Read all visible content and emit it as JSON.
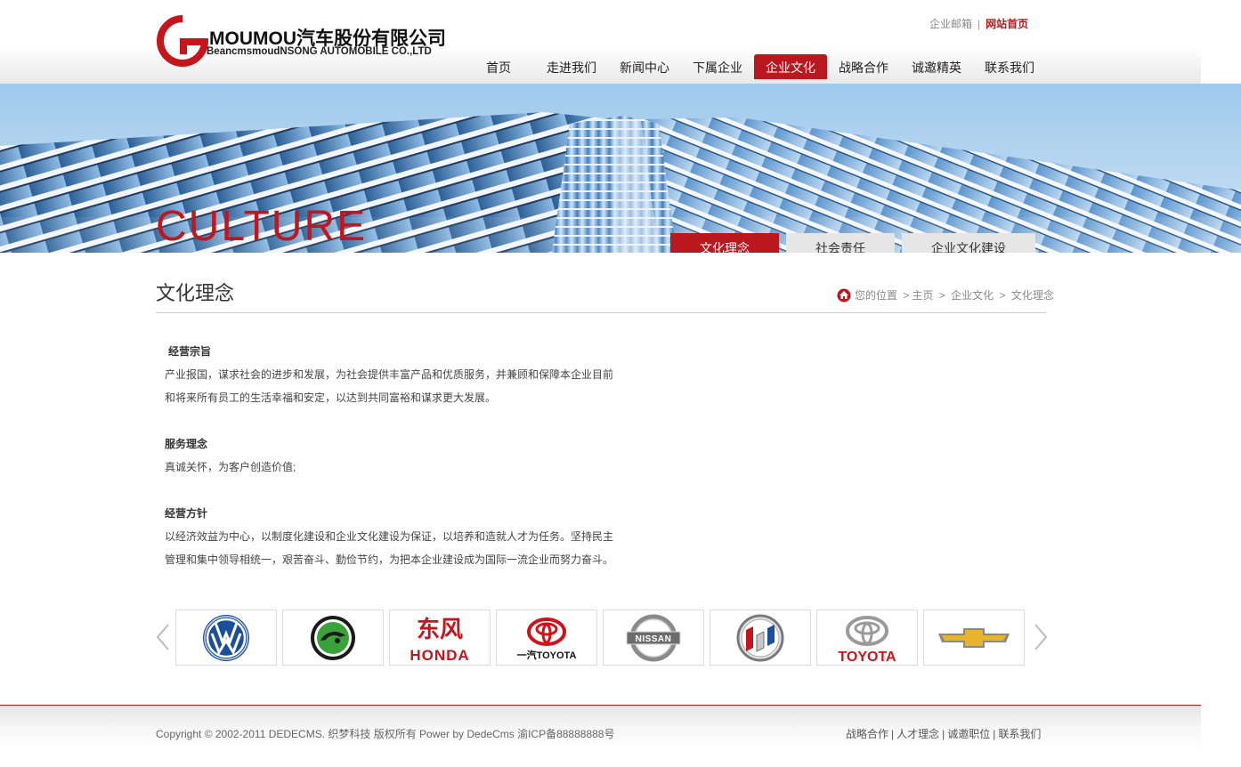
{
  "header": {
    "logo_cn_brand": "MOUMOU",
    "logo_cn_rest": "汽车股份有限公司",
    "logo_en": "BeancmsmoudNSONG AUTOMOBILE CO.,LTD",
    "top_links": {
      "mail": "企业邮箱",
      "separator": "|",
      "home": "网站首页"
    },
    "nav": [
      {
        "label": "首页",
        "active": false
      },
      {
        "label": "走进我们",
        "active": false
      },
      {
        "label": "新闻中心",
        "active": false
      },
      {
        "label": "下属企业",
        "active": false
      },
      {
        "label": "企业文化",
        "active": true
      },
      {
        "label": "战略合作",
        "active": false
      },
      {
        "label": "诚邀精英",
        "active": false
      },
      {
        "label": "联系我们",
        "active": false
      }
    ]
  },
  "banner": {
    "title": "CULTURE",
    "subtabs": [
      {
        "label": "文化理念",
        "active": true
      },
      {
        "label": "社会责任",
        "active": false
      },
      {
        "label": "企业文化建设",
        "active": false
      }
    ]
  },
  "content": {
    "title": "文化理念",
    "breadcrumb": {
      "prefix": "您的位置",
      "items": [
        "主页",
        "企业文化",
        "文化理念"
      ],
      "lead": ">",
      "separator": ">"
    },
    "sections": [
      {
        "heading": "经营宗旨",
        "lines": [
          "产业报国，谋求社会的进步和发展，为社会提供丰富产品和优质服务，并兼顾和保障本企业目前",
          "和将来所有员工的生活幸福和安定，以达到共同富裕和谋求更大发展。"
        ]
      },
      {
        "heading": "服务理念",
        "lines": [
          "真诚关怀，为客户创造价值;"
        ]
      },
      {
        "heading": "经营方针",
        "lines": [
          "以经济效益为中心，以制度化建设和企业文化建设为保证，以培养和造就人才为任务。坚持民主",
          "管理和集中领导相统一，艰苦奋斗、勤俭节约，为把本企业建设成为国际一流企业而努力奋斗。"
        ]
      }
    ]
  },
  "partners": {
    "logos": [
      {
        "name": "volkswagen-logo"
      },
      {
        "name": "skoda-logo"
      },
      {
        "name": "dongfeng-honda-logo",
        "text_top": "东风",
        "text_bottom": "HONDA"
      },
      {
        "name": "faw-toyota-logo",
        "text": "一汽TOYOTA"
      },
      {
        "name": "nissan-logo",
        "text": "NISSAN"
      },
      {
        "name": "buick-logo"
      },
      {
        "name": "toyota-logo",
        "text": "TOYOTA"
      },
      {
        "name": "chevrolet-logo"
      }
    ]
  },
  "footer": {
    "copyright": "Copyright © 2002-2011 DEDECMS. 织梦科技 版权所有 Power by DedeCms 渝ICP备88888888号",
    "links": [
      "战略合作",
      "人才理念",
      "诚邀职位",
      "联系我们"
    ],
    "separator": "|"
  },
  "colors": {
    "accent": "#b8181e",
    "text": "#333333",
    "muted": "#888888"
  }
}
